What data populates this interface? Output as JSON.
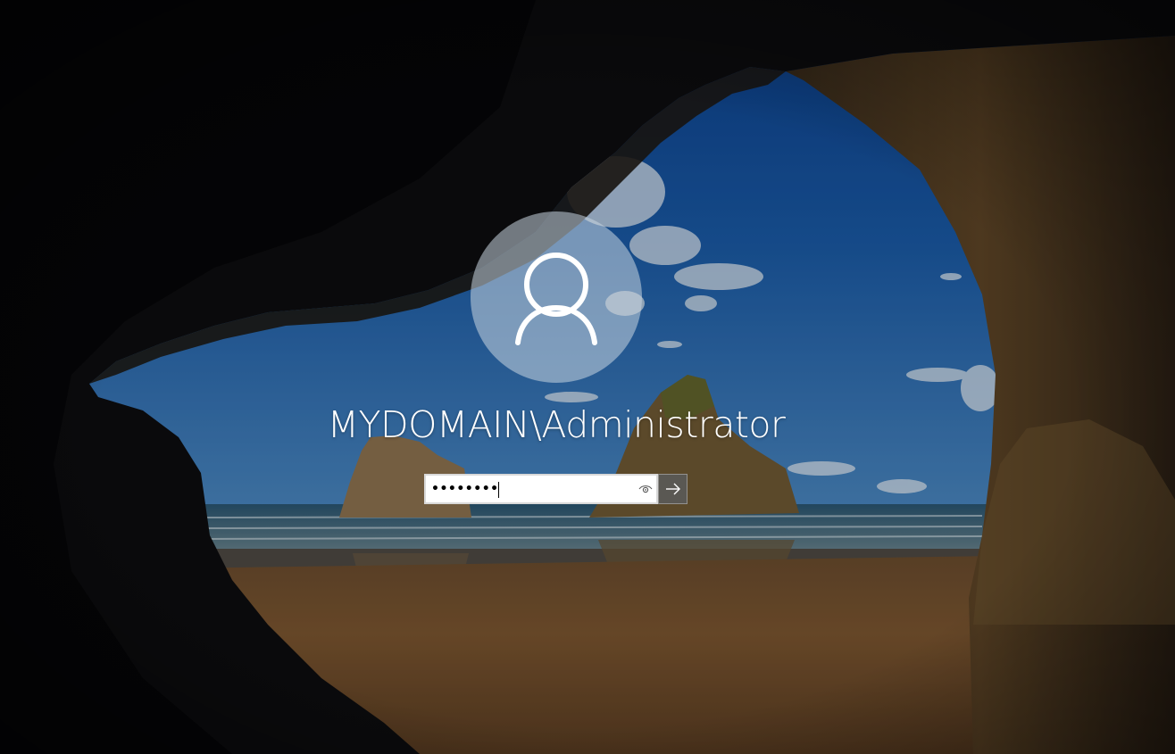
{
  "login": {
    "username": "MYDOMAIN\\Administrator",
    "password_masked": "••••••••"
  },
  "icons": {
    "avatar": "user-silhouette-icon",
    "reveal": "eye-icon",
    "submit": "arrow-right-icon"
  },
  "colors": {
    "text": "#ffffff",
    "avatar_fill": "#c8d6e0",
    "submit_bg": "#5a5a5a"
  }
}
